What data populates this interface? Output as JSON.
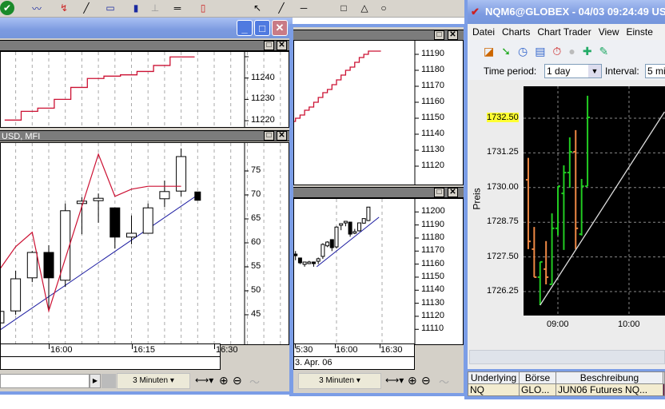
{
  "top_toolbar": {
    "icons": [
      "connect-icon",
      "line-chart-icon",
      "indicator-icon",
      "draw-line-icon",
      "chart-window-icon",
      "volume-chart-icon",
      "price-ruler-icon",
      "horizontal-ruler-icon",
      "candlestick-icon",
      "pointer-icon",
      "line-tool-icon"
    ]
  },
  "left_window": {
    "pane_top": {
      "y_labels": [
        "11240",
        "11230",
        "11220"
      ]
    },
    "pane_bottom": {
      "title": "USD, MFI",
      "y_labels": [
        "75",
        "70",
        "65",
        "60",
        "55",
        "50",
        "45"
      ]
    },
    "x_labels": [
      "16:00",
      "16:15",
      "16:30"
    ],
    "interval": "3 Minuten"
  },
  "middle_window": {
    "pane_top": {
      "y_labels": [
        "11190",
        "11180",
        "11170",
        "11160",
        "11150",
        "11140",
        "11130",
        "11120"
      ]
    },
    "pane_bottom": {
      "y_labels": [
        "11200",
        "11190",
        "11180",
        "11170",
        "11160",
        "11150",
        "11140",
        "11130",
        "11120",
        "11110"
      ]
    },
    "x_labels": [
      "5:30",
      "16:00",
      "16:30"
    ],
    "date": "3. Apr. 06",
    "interval": "3 Minuten"
  },
  "right_window": {
    "title": "NQM6@GLOBEX - 04/03 09:24:49 US",
    "menu": [
      "Datei",
      "Charts",
      "Chart Trader",
      "View",
      "Einste"
    ],
    "time_period_label": "Time period:",
    "time_period_value": "1 day",
    "interval_label": "Interval:",
    "interval_value": "5 mi",
    "y_axis_title": "Preis",
    "y_labels": [
      "1732.50",
      "1731.25",
      "1730.00",
      "1728.75",
      "1727.50",
      "1726.25"
    ],
    "highlight_label": "1732.50",
    "x_labels": [
      "09:00",
      "10:00"
    ],
    "table": {
      "headers": [
        "Underlying",
        "Börse",
        "Beschreibung"
      ],
      "row": [
        "NQ",
        "GLO...",
        "JUN06 Futures NQ..."
      ]
    }
  },
  "colors": {
    "up_bar": "#22cc22",
    "down_bar": "#ee8844",
    "mfi_line": "#cc1133",
    "trend_line": "#1a1aa0",
    "highlight": "#ffff33"
  },
  "chart_data": [
    {
      "id": "left-top",
      "type": "line",
      "style": "step",
      "series": [
        {
          "t": "15:52",
          "v": 11220.3
        },
        {
          "t": "15:55",
          "v": 11224.4
        },
        {
          "t": "15:58",
          "v": 11225.9
        },
        {
          "t": "16:01",
          "v": 11230
        },
        {
          "t": "16:04",
          "v": 11235.6
        },
        {
          "t": "16:07",
          "v": 11239.8
        },
        {
          "t": "16:10",
          "v": 11240.9
        },
        {
          "t": "16:13",
          "v": 11241.5
        },
        {
          "t": "16:16",
          "v": 11243.1
        },
        {
          "t": "16:19",
          "v": 11245.9
        },
        {
          "t": "16:22",
          "v": 11249.9
        },
        {
          "t": "16:25",
          "v": 11249.9
        }
      ],
      "ylim": [
        11215,
        11255
      ]
    },
    {
      "id": "left-bottom",
      "type": "candlestick",
      "ylim": [
        40,
        82
      ],
      "candles": [
        {
          "t": "15:51",
          "o": 43.3,
          "h": 45.7,
          "l": 43.3,
          "c": 45.7
        },
        {
          "t": "15:54",
          "o": 45.8,
          "h": 54.2,
          "l": 45.0,
          "c": 52.5
        },
        {
          "t": "15:57",
          "o": 52.7,
          "h": 58.3,
          "l": 51.8,
          "c": 58.0
        },
        {
          "t": "16:00",
          "o": 58.0,
          "h": 59.5,
          "l": 45.8,
          "c": 52.7
        },
        {
          "t": "16:03",
          "o": 52.2,
          "h": 68.2,
          "l": 50.8,
          "c": 66.7
        },
        {
          "t": "16:06",
          "o": 68.2,
          "h": 69.5,
          "l": 61.8,
          "c": 68.7
        },
        {
          "t": "16:09",
          "o": 68.8,
          "h": 70.3,
          "l": 64.2,
          "c": 69.3
        },
        {
          "t": "16:12",
          "o": 67.3,
          "h": 67.3,
          "l": 58.8,
          "c": 61.2
        },
        {
          "t": "16:15",
          "o": 61.2,
          "h": 65.7,
          "l": 59.7,
          "c": 62.0
        },
        {
          "t": "16:18",
          "o": 62.0,
          "h": 68.2,
          "l": 62.0,
          "c": 67.3
        },
        {
          "t": "16:21",
          "o": 69.2,
          "h": 73.0,
          "l": 67.5,
          "c": 70.7
        },
        {
          "t": "16:24",
          "o": 70.8,
          "h": 79.7,
          "l": 69.7,
          "c": 78.0
        },
        {
          "t": "16:27",
          "o": 70.7,
          "h": 70.7,
          "l": 69.3,
          "c": 69.3
        }
      ],
      "mfi": [
        {
          "t": "15:51",
          "v": 54.3
        },
        {
          "t": "15:54",
          "v": 59.2
        },
        {
          "t": "15:57",
          "v": 62.2
        },
        {
          "t": "16:00",
          "v": 45.8
        },
        {
          "t": "16:09",
          "v": 78.5
        },
        {
          "t": "16:12",
          "v": 69.7
        },
        {
          "t": "16:15",
          "v": 71.2
        },
        {
          "t": "16:18",
          "v": 71.8
        },
        {
          "t": "16:24",
          "v": 71.8
        }
      ],
      "trendline": [
        {
          "t": "15:51",
          "v": 41.7
        },
        {
          "t": "16:27",
          "v": 70.0
        }
      ]
    },
    {
      "id": "middle-top",
      "type": "line",
      "style": "step",
      "ylim": [
        11110,
        11200
      ],
      "series": [
        {
          "t": "15:30",
          "v": 11148
        },
        {
          "t": "15:33",
          "v": 11150
        },
        {
          "t": "15:36",
          "v": 11152
        },
        {
          "t": "15:39",
          "v": 11155
        },
        {
          "t": "15:42",
          "v": 11157
        },
        {
          "t": "15:45",
          "v": 11160
        },
        {
          "t": "15:48",
          "v": 11163
        },
        {
          "t": "15:51",
          "v": 11166
        },
        {
          "t": "15:54",
          "v": 11168
        },
        {
          "t": "15:57",
          "v": 11171
        },
        {
          "t": "16:00",
          "v": 11174
        },
        {
          "t": "16:03",
          "v": 11177
        },
        {
          "t": "16:06",
          "v": 11180
        },
        {
          "t": "16:09",
          "v": 11182
        },
        {
          "t": "16:12",
          "v": 11185
        },
        {
          "t": "16:15",
          "v": 11188
        },
        {
          "t": "16:18",
          "v": 11190
        },
        {
          "t": "16:21",
          "v": 11192
        },
        {
          "t": "16:24",
          "v": 11192
        }
      ]
    },
    {
      "id": "middle-bottom",
      "type": "candlestick",
      "ylim": [
        11105,
        11205
      ],
      "candles": [
        {
          "t": "15:30",
          "o": 11173.9,
          "h": 11174.5,
          "l": 11168,
          "c": 11168.3
        },
        {
          "t": "15:33",
          "o": 11167.7,
          "h": 11170,
          "l": 11163,
          "c": 11166.5
        },
        {
          "t": "15:36",
          "o": 11164.7,
          "h": 11165,
          "l": 11160,
          "c": 11161
        },
        {
          "t": "15:39",
          "o": 11159.8,
          "h": 11161.6,
          "l": 11158,
          "c": 11161.6
        },
        {
          "t": "15:42",
          "o": 11161,
          "h": 11162.5,
          "l": 11160,
          "c": 11161.6
        },
        {
          "t": "15:45",
          "o": 11161.6,
          "h": 11162,
          "l": 11158,
          "c": 11160.8
        },
        {
          "t": "15:48",
          "o": 11162.2,
          "h": 11165,
          "l": 11160,
          "c": 11164.1
        },
        {
          "t": "15:51",
          "o": 11165.9,
          "h": 11176,
          "l": 11164,
          "c": 11175.1
        },
        {
          "t": "15:54",
          "o": 11174,
          "h": 11177.5,
          "l": 11173,
          "c": 11176.9
        },
        {
          "t": "15:57",
          "o": 11178.8,
          "h": 11179,
          "l": 11170,
          "c": 11172.6
        },
        {
          "t": "16:00",
          "o": 11173.2,
          "h": 11189,
          "l": 11172,
          "c": 11188.4
        },
        {
          "t": "16:03",
          "o": 11190.4,
          "h": 11191,
          "l": 11186,
          "c": 11191
        },
        {
          "t": "16:06",
          "o": 11191.6,
          "h": 11193,
          "l": 11189,
          "c": 11192.8
        },
        {
          "t": "16:09",
          "o": 11192.2,
          "h": 11192.5,
          "l": 11181,
          "c": 11183
        },
        {
          "t": "16:12",
          "o": 11184.3,
          "h": 11187,
          "l": 11183,
          "c": 11184.9
        },
        {
          "t": "16:15",
          "o": 11185.5,
          "h": 11191.6,
          "l": 11185,
          "c": 11191.6
        },
        {
          "t": "16:18",
          "o": 11191.4,
          "h": 11195,
          "l": 11191,
          "c": 11194.9
        },
        {
          "t": "16:21",
          "o": 11193.4,
          "h": 11203.7,
          "l": 11193,
          "c": 11203.7
        }
      ],
      "trendline": [
        {
          "t": "15:47",
          "v": 11158
        },
        {
          "t": "16:28",
          "v": 11196
        }
      ]
    },
    {
      "id": "right",
      "type": "ohlc",
      "ylim": [
        1725.5,
        1733.5
      ],
      "bars": [
        {
          "t": "08:35",
          "o": 1730.28,
          "h": 1731.07,
          "l": 1727.78,
          "c": 1728.06
        },
        {
          "t": "08:40",
          "o": 1727.78,
          "h": 1728.58,
          "l": 1726.77,
          "c": 1726.77
        },
        {
          "t": "08:45",
          "o": 1726.77,
          "h": 1727.32,
          "l": 1725.76,
          "c": 1727.32
        },
        {
          "t": "08:50",
          "o": 1727.06,
          "h": 1728.07,
          "l": 1726.51,
          "c": 1726.77
        },
        {
          "t": "08:55",
          "o": 1726.51,
          "h": 1729.07,
          "l": 1726.51,
          "c": 1728.53
        },
        {
          "t": "09:00",
          "o": 1728.53,
          "h": 1730.05,
          "l": 1728.27,
          "c": 1730.05
        },
        {
          "t": "09:05",
          "o": 1729.79,
          "h": 1730.8,
          "l": 1727.75,
          "c": 1730.54
        },
        {
          "t": "09:10",
          "o": 1730.54,
          "h": 1731.81,
          "l": 1729.99,
          "c": 1731.29
        },
        {
          "t": "09:15",
          "o": 1731.29,
          "h": 1732.07,
          "l": 1727.78,
          "c": 1728.53
        },
        {
          "t": "09:20",
          "o": 1728.32,
          "h": 1730.31,
          "l": 1728.27,
          "c": 1730.05
        },
        {
          "t": "09:25",
          "o": 1730.05,
          "h": 1733.31,
          "l": 1730.05,
          "c": 1732.53
        }
      ],
      "trendline": [
        {
          "t": "08:45",
          "v": 1725.76
        },
        {
          "t": "10:30",
          "v": 1732.73
        }
      ]
    }
  ]
}
